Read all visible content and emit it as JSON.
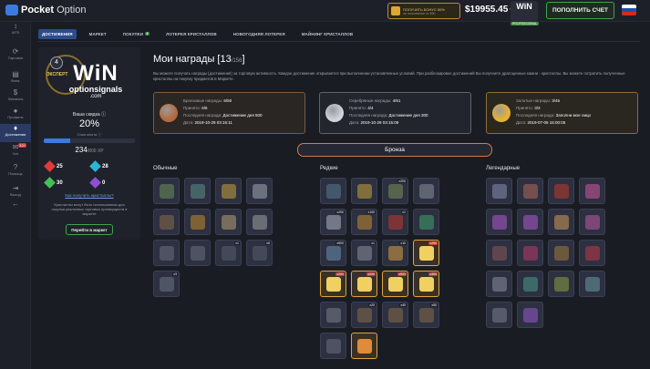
{
  "app": {
    "logo_bold": "Pocket",
    "logo_light": "Option"
  },
  "topbar": {
    "bonus_title": "ПОЛУЧИТЬ БОНУС 50%",
    "bonus_sub": "на пополнение от $50",
    "balance": "$19955.45",
    "win_badge": "WiN",
    "win_badge_sub": "PROFESSIONAL",
    "topup_label": "ПОПОЛНИТЬ СЧЕТ",
    "flag_colors": [
      "#ffffff",
      "#1c4fb4",
      "#d52b1e"
    ]
  },
  "sidebar": {
    "items": [
      {
        "icon": "↕",
        "label": "МТ5",
        "name": "sidebar-item-mt5"
      },
      {
        "icon": "⟳",
        "label": "Торговля",
        "name": "sidebar-item-trading"
      },
      {
        "icon": "▤",
        "label": "Фина.",
        "name": "sidebar-item-finance"
      },
      {
        "icon": "$",
        "label": "Финансы",
        "name": "sidebar-item-payments"
      },
      {
        "icon": "●",
        "label": "Профиль",
        "name": "sidebar-item-profile"
      },
      {
        "icon": "♦",
        "label": "Достижения",
        "name": "sidebar-item-achievements"
      },
      {
        "icon": "✉",
        "label": "Чат",
        "name": "sidebar-item-chat"
      },
      {
        "icon": "?",
        "label": "Помощь",
        "name": "sidebar-item-help"
      },
      {
        "icon": "⇥",
        "label": "Выход",
        "name": "sidebar-item-logout"
      },
      {
        "icon": "←",
        "label": "",
        "name": "sidebar-item-collapse"
      }
    ],
    "chat_badge": "320"
  },
  "tabs": [
    {
      "label": "ДОСТИЖЕНИЯ",
      "name": "tab-achievements"
    },
    {
      "label": "МАРКЕТ",
      "name": "tab-market"
    },
    {
      "label": "ПОКУПКИ",
      "name": "tab-purchases",
      "badge": "3"
    },
    {
      "label": "ЛОТЕРЕЯ КРИСТАЛЛОВ",
      "name": "tab-lottery"
    },
    {
      "label": "НОВОГОДНЯЯ ЛОТЕРЕЯ",
      "name": "tab-newyear-lottery"
    },
    {
      "label": "МАЙНИНГ КРИСТАЛЛОВ",
      "name": "tab-mining"
    }
  ],
  "profile": {
    "level": "4",
    "level_sub": "ЭКСПЕРТ",
    "avatar_big": "WiN",
    "avatar_sub": "optionsignals",
    "avatar_com": ".com",
    "discount_label": "Ваша скидка",
    "discount": "20%",
    "xp_label": "Очки опыта",
    "xp_value": "234",
    "xp_unit": "/800 XP",
    "xp_fraction": 0.29,
    "gems": [
      {
        "color": "#e53935",
        "count": "25",
        "name": "gem-red"
      },
      {
        "color": "#29b6d6",
        "count": "28",
        "name": "gem-blue"
      },
      {
        "color": "#43c157",
        "count": "30",
        "name": "gem-green"
      },
      {
        "color": "#8e4fd6",
        "count": "0",
        "name": "gem-purple"
      }
    ],
    "how_link": "Как получить кристаллы?",
    "note": "Кристаллы могут быть использованы для покупки различных торговых преимуществ в маркете",
    "market_button": "Перейти в маркет"
  },
  "main": {
    "title": "Мои награды",
    "count": "13",
    "count_total": "/156",
    "intro": "Вы можете получать награды (достижения) за торговую активность. Каждое достижение открывается при выполнении установленных условий. При разблокировке достижений Вы получаете драгоценные камни - кристаллы. Вы можете потратить полученные кристаллы на покупку предметов в Маркете."
  },
  "cards": [
    {
      "name": "card-bronze",
      "cls": "bronze",
      "medal": "#b5693f",
      "r1l": "Бронзовые награды:",
      "r1v": "6/50",
      "r2l": "Принято:",
      "r2v": "6/6",
      "r3l": "Последняя награда:",
      "r3v": "Достижение дня 500",
      "r4l": "Дата:",
      "r4v": "2019-10-29 03:15:11"
    },
    {
      "name": "card-silver",
      "cls": "silver",
      "medal": "#cfd3db",
      "r1l": "Серебряные награды:",
      "r1v": "4/61",
      "r2l": "Принято:",
      "r2v": "4/4",
      "r3l": "Последняя награда:",
      "r3v": "Достижение дня 300",
      "r4l": "Дата:",
      "r4v": "2019-10-29 03:15:09"
    },
    {
      "name": "card-gold",
      "cls": "gold",
      "medal": "#e7b22e",
      "r1l": "Золотые награды:",
      "r1v": "3/45",
      "r2l": "Принято:",
      "r2v": "3/3",
      "r3l": "Последняя награда:",
      "r3v": "Заполни мое лицо",
      "r4l": "Дата:",
      "r4v": "2019-07-05 15:00:05"
    }
  ],
  "level_pill": "Бронза",
  "columns": [
    "Обычные",
    "Редкие",
    "Легендарные"
  ],
  "rewards": {
    "common": [
      {
        "c": "#6b8f5a",
        "r": ""
      },
      {
        "c": "#5d8f86",
        "r": ""
      },
      {
        "c": "#c9a23a",
        "r": ""
      },
      {
        "c": "#a3a7b3",
        "r": ""
      },
      {
        "c": "#8a6b4a",
        "r": ""
      },
      {
        "c": "#c48a2e",
        "r": ""
      },
      {
        "c": "#b8a070",
        "r": ""
      },
      {
        "c": "#a0a0a0",
        "r": ""
      },
      {
        "c": "#6b7080",
        "r": ""
      },
      {
        "c": "#6b7080",
        "r": ""
      },
      {
        "c": "#5a5f70",
        "r": "x1"
      },
      {
        "c": "#5a5f70",
        "r": "x5"
      },
      {
        "c": "#707585",
        "r": "x3"
      }
    ],
    "rare": [
      {
        "c": "#5a7a90",
        "r": ""
      },
      {
        "c": "#c9a23a",
        "r": ""
      },
      {
        "c": "#7a8f5a",
        "r": "x200"
      },
      {
        "c": "#8a8f9a",
        "r": ""
      },
      {
        "c": "#b0b4c0",
        "r": "x200"
      },
      {
        "c": "#c48a2e",
        "r": "x100"
      },
      {
        "c": "#c0392b",
        "r": "x1"
      },
      {
        "c": "#3fa36a",
        "r": ""
      },
      {
        "c": "#6b8fb0",
        "r": "x500"
      },
      {
        "c": "#8a8f9a",
        "r": "x1"
      },
      {
        "c": "#d8a040",
        "r": "x10"
      },
      {
        "c": "#f0d060",
        "r": "x250",
        "lit": 1
      },
      {
        "c": "#f0d060",
        "r": "x200",
        "lit": 1
      },
      {
        "c": "#f0d060",
        "r": "x200",
        "lit": 1
      },
      {
        "c": "#f0d060",
        "r": "x500",
        "lit": 1
      },
      {
        "c": "#f0d060",
        "r": "x300",
        "lit": 1
      },
      {
        "c": "#7a7f8a",
        "r": ""
      },
      {
        "c": "#8a6b4a",
        "r": "x20"
      },
      {
        "c": "#8a6b4a",
        "r": "x40"
      },
      {
        "c": "#8a6b4a",
        "r": "x50"
      },
      {
        "c": "#6b7080",
        "r": ""
      },
      {
        "c": "#e08a3a",
        "r": "",
        "lit": 1
      }
    ],
    "legendary": [
      {
        "c": "#8a8fb0",
        "r": ""
      },
      {
        "c": "#b06a5a",
        "r": ""
      },
      {
        "c": "#c0392b",
        "r": ""
      },
      {
        "c": "#d05aa0",
        "r": ""
      },
      {
        "c": "#b05ad0",
        "r": ""
      },
      {
        "c": "#b05ad0",
        "r": ""
      },
      {
        "c": "#d09a5a",
        "r": ""
      },
      {
        "c": "#c05aa0",
        "r": ""
      },
      {
        "c": "#8a5a5a",
        "r": ""
      },
      {
        "c": "#c03a6a",
        "r": ""
      },
      {
        "c": "#a07a3a",
        "r": ""
      },
      {
        "c": "#c0394b",
        "r": ""
      },
      {
        "c": "#8a8f9a",
        "r": ""
      },
      {
        "c": "#4a9a8a",
        "r": ""
      },
      {
        "c": "#8aa040",
        "r": ""
      },
      {
        "c": "#6a9aa0",
        "r": ""
      },
      {
        "c": "#7a7f8a",
        "r": ""
      },
      {
        "c": "#9a5ad0",
        "r": ""
      }
    ]
  }
}
